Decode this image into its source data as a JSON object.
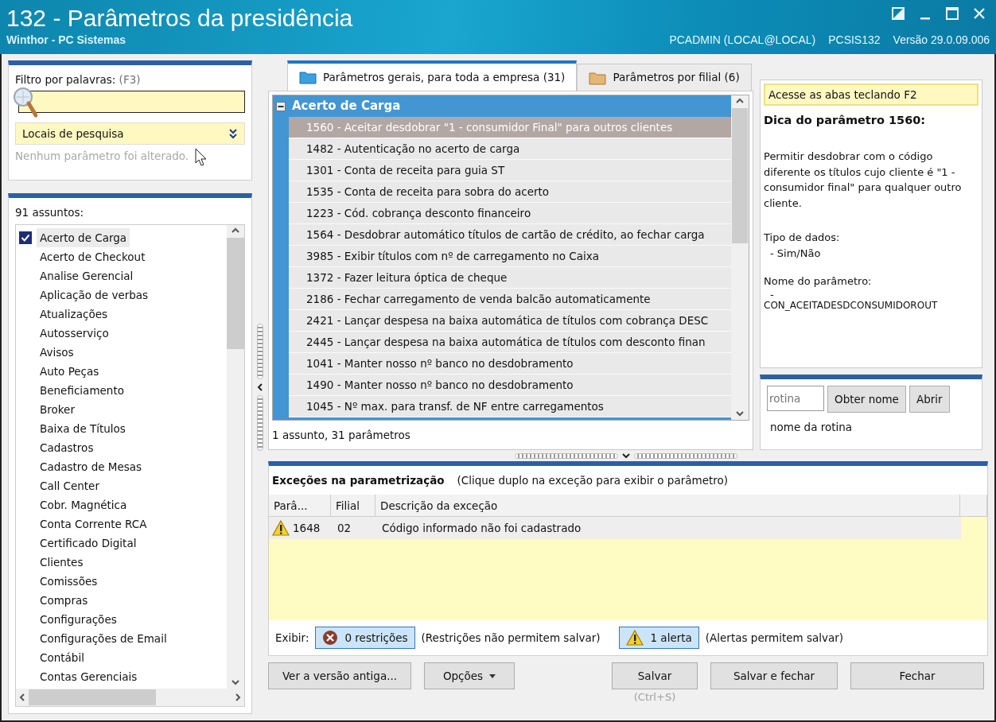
{
  "window": {
    "title": "132 - Parâmetros da presidência",
    "subtitle": "Winthor - PC Sistemas",
    "user": "PCADMIN (LOCAL@LOCAL)",
    "routine": "PCSIS132",
    "version": "Versão  29.0.09.006"
  },
  "filter": {
    "label": "Filtro por palavras:",
    "shortcut": "(F3)",
    "search_locations": "Locais de pesquisa",
    "status": "Nenhum parâmetro foi alterado."
  },
  "subjects": {
    "count_label": "91 assuntos:",
    "items": [
      {
        "label": "Acerto de Carga",
        "checked": true
      },
      {
        "label": "Acerto de Checkout",
        "checked": false
      },
      {
        "label": "Analise Gerencial",
        "checked": false
      },
      {
        "label": "Aplicação de verbas",
        "checked": false
      },
      {
        "label": "Atualizações",
        "checked": false
      },
      {
        "label": "Autosserviço",
        "checked": false
      },
      {
        "label": "Avisos",
        "checked": false
      },
      {
        "label": "Auto Peças",
        "checked": false
      },
      {
        "label": "Beneficiamento",
        "checked": false
      },
      {
        "label": "Broker",
        "checked": false
      },
      {
        "label": "Baixa de Títulos",
        "checked": false
      },
      {
        "label": "Cadastros",
        "checked": false
      },
      {
        "label": "Cadastro de Mesas",
        "checked": false
      },
      {
        "label": "Call Center",
        "checked": false
      },
      {
        "label": "Cobr. Magnética",
        "checked": false
      },
      {
        "label": "Conta Corrente RCA",
        "checked": false
      },
      {
        "label": "Certificado Digital",
        "checked": false
      },
      {
        "label": "Clientes",
        "checked": false
      },
      {
        "label": "Comissões",
        "checked": false
      },
      {
        "label": "Compras",
        "checked": false
      },
      {
        "label": "Configurações",
        "checked": false
      },
      {
        "label": "Configurações de Email",
        "checked": false
      },
      {
        "label": "Contábil",
        "checked": false
      },
      {
        "label": "Contas Gerenciais",
        "checked": false
      }
    ]
  },
  "tabs": [
    {
      "label": "Parâmetros gerais, para toda a empresa  (31)",
      "selected": true
    },
    {
      "label": "Parâmetros por filial  (6)",
      "selected": false
    }
  ],
  "parameters": {
    "group": "Acerto de Carga",
    "expanded": true,
    "rows": [
      {
        "label": "1560 - Aceitar desdobrar \"1 - consumidor Final\" para outros clientes",
        "selected": true
      },
      {
        "label": "1482 - Autenticação no acerto de carga",
        "selected": false
      },
      {
        "label": "1301 - Conta de receita para guia ST",
        "selected": false
      },
      {
        "label": "1535 - Conta de receita para sobra do acerto",
        "selected": false
      },
      {
        "label": "1223 - Cód. cobrança desconto financeiro",
        "selected": false
      },
      {
        "label": "1564 - Desdobrar automático títulos de cartão de crédito, ao fechar carga",
        "selected": false
      },
      {
        "label": "3985 - Exibir títulos com nº de carregamento no Caixa",
        "selected": false
      },
      {
        "label": "1372 - Fazer leitura óptica de cheque",
        "selected": false
      },
      {
        "label": "2186 - Fechar carregamento de venda balcão automaticamente",
        "selected": false
      },
      {
        "label": "2421 - Lançar despesa na baixa automática de títulos com cobrança DESC",
        "selected": false
      },
      {
        "label": "2445 - Lançar despesa na baixa automática de títulos com desconto finan",
        "selected": false
      },
      {
        "label": "1041 - Manter nosso nº banco no desdobramento",
        "selected": false
      },
      {
        "label": "1490 - Manter nosso nº banco no desdobramento",
        "selected": false
      },
      {
        "label": "1045 - Nº max. para transf. de NF entre carregamentos",
        "selected": false
      }
    ],
    "summary": "1 assunto, 31 parâmetros"
  },
  "tip": {
    "hint": "Acesse as abas teclando F2",
    "title": "Dica do parâmetro 1560:",
    "description": "Permitir desdobrar com o código diferente os títulos cujo cliente é \"1 - consumidor final\" para qualquer outro cliente.",
    "data_type_label": "Tipo de dados:",
    "data_type": "- Sim/Não",
    "name_label": "Nome do parâmetro:",
    "name_dash": "-",
    "name": "CON_ACEITADESDCONSUMIDOROUT"
  },
  "routine": {
    "placeholder": "rotina",
    "get_name": "Obter nome",
    "open": "Abrir",
    "name": "nome da rotina"
  },
  "exceptions": {
    "title": "Exceções na parametrização",
    "hint": "(Clique duplo na exceção para exibir o parâmetro)",
    "columns": [
      "Parâ...",
      "Filial",
      "Descrição da exceção"
    ],
    "rows": [
      {
        "kind": "alert",
        "cells": [
          "1648",
          "02",
          "Código informado não foi cadastrado"
        ]
      }
    ],
    "show_label": "Exibir:",
    "toggles": [
      {
        "kind": "restriction",
        "label": "0 restrições",
        "note": "(Restrições não permitem salvar)",
        "on": true
      },
      {
        "kind": "alert",
        "label": "1 alerta",
        "note": "(Alertas permitem salvar)",
        "on": true
      }
    ]
  },
  "buttons": {
    "old_version": "Ver a versão antiga...",
    "options": "Opções",
    "save": "Salvar",
    "save_shortcut": "(Ctrl+S)",
    "save_close": "Salvar e fechar",
    "close": "Fechar"
  }
}
